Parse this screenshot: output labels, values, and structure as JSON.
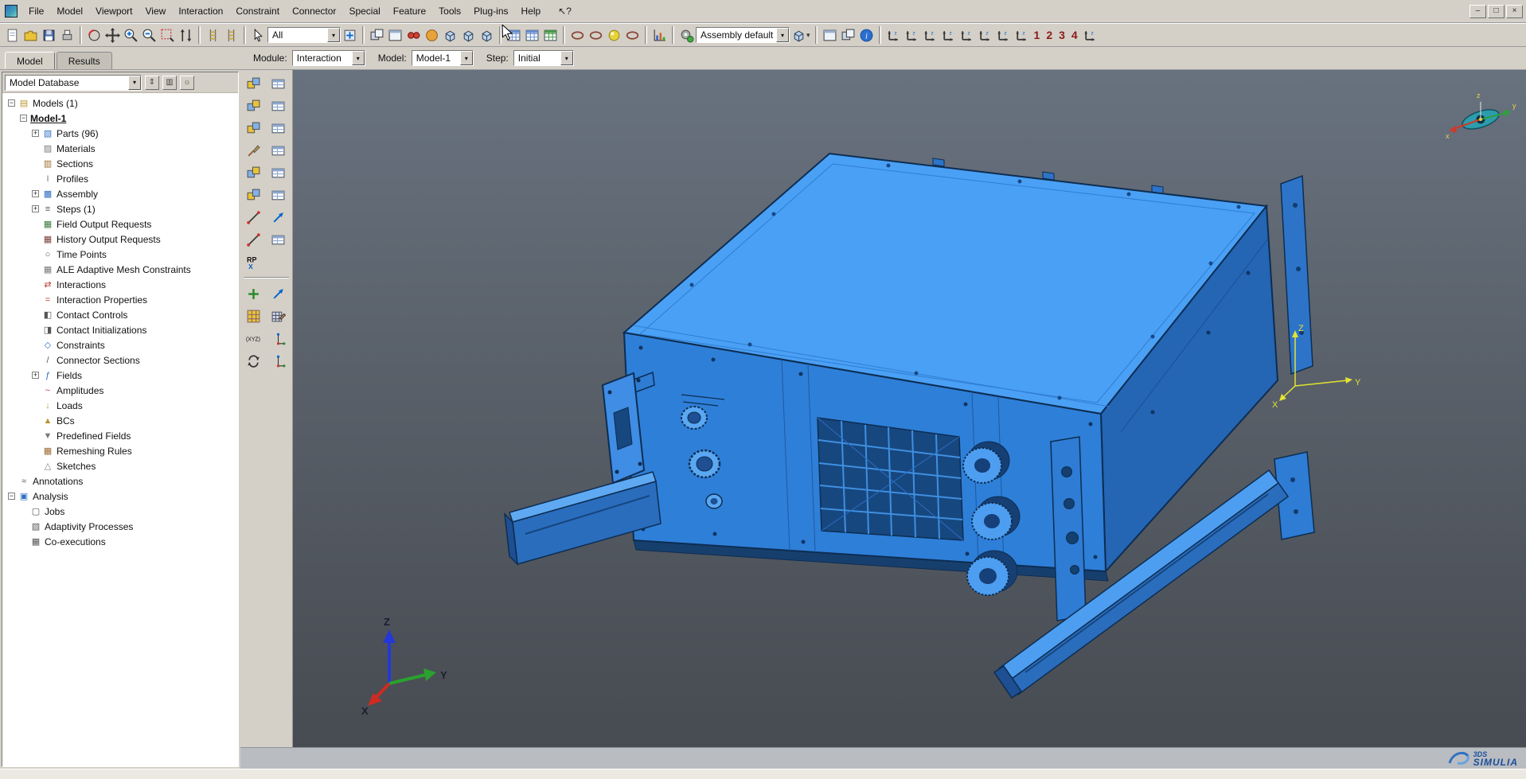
{
  "window": {
    "controls": [
      "minimize",
      "maximize",
      "close"
    ]
  },
  "menu_bar": {
    "items": [
      "File",
      "Model",
      "Viewport",
      "View",
      "Interaction",
      "Constraint",
      "Connector",
      "Special",
      "Feature",
      "Tools",
      "Plug-ins",
      "Help"
    ]
  },
  "toolbar": {
    "filter_combo": {
      "value": "All"
    },
    "defaults_combo": {
      "value": "Assembly defaults"
    },
    "viewport_numbers": [
      "1",
      "2",
      "3",
      "4"
    ],
    "groups": [
      [
        "new-file",
        "open-file",
        "save-file",
        "print"
      ],
      [
        "rotate-view",
        "pan-view",
        "magnify",
        "reduce",
        "box-zoom",
        "fit-view"
      ],
      [
        "create-display-group",
        "display-group-manager"
      ],
      [
        "select-tool",
        "combo:filter",
        "selection-add"
      ],
      [
        "overlay-viewports",
        "edit-viewport",
        "viewport-annotations",
        "shaded-render",
        "wireframe-view",
        "hiddenline-view",
        "shaded-view"
      ],
      [
        "field-output-table",
        "history-output-table",
        "data-table"
      ],
      [
        "beam-profile-a",
        "beam-profile-b",
        "sphere-render",
        "beam-profile-c"
      ],
      [
        "xy-plot"
      ],
      [
        "color-code",
        "combo:defaults",
        "color-dialog",
        "dropdown-arrow"
      ],
      [
        "create-viewport",
        "viewport-manager",
        "context-info"
      ],
      [
        "view-front",
        "view-back",
        "view-top",
        "view-bottom",
        "view-left",
        "view-right",
        "view-iso",
        "view-rotate3d",
        "num:0",
        "num:1",
        "num:2",
        "num:3",
        "custom-views"
      ]
    ]
  },
  "tabs": {
    "model": "Model",
    "results": "Results"
  },
  "context_bar": {
    "module_label": "Module:",
    "module_value": "Interaction",
    "model_label": "Model:",
    "model_value": "Model-1",
    "step_label": "Step:",
    "step_value": "Initial"
  },
  "model_tree": {
    "combo_value": "Model Database",
    "items": [
      {
        "label": "Models (1)",
        "depth": 0,
        "exp": "minus",
        "icon": "models-folder"
      },
      {
        "label": "Model-1",
        "depth": 1,
        "exp": "minus",
        "icon": null,
        "emph": true
      },
      {
        "label": "Parts (96)",
        "depth": 2,
        "exp": "plus",
        "icon": "parts"
      },
      {
        "label": "Materials",
        "depth": 2,
        "exp": null,
        "icon": "materials"
      },
      {
        "label": "Sections",
        "depth": 2,
        "exp": null,
        "icon": "sections"
      },
      {
        "label": "Profiles",
        "depth": 2,
        "exp": null,
        "icon": "profiles"
      },
      {
        "label": "Assembly",
        "depth": 2,
        "exp": "plus",
        "icon": "assembly"
      },
      {
        "label": "Steps (1)",
        "depth": 2,
        "exp": "plus",
        "icon": "steps"
      },
      {
        "label": "Field Output Requests",
        "depth": 2,
        "exp": null,
        "icon": "field-output"
      },
      {
        "label": "History Output Requests",
        "depth": 2,
        "exp": null,
        "icon": "history-output"
      },
      {
        "label": "Time Points",
        "depth": 2,
        "exp": null,
        "icon": "time-points"
      },
      {
        "label": "ALE Adaptive Mesh Constraints",
        "depth": 2,
        "exp": null,
        "icon": "ale-mesh"
      },
      {
        "label": "Interactions",
        "depth": 2,
        "exp": null,
        "icon": "interactions"
      },
      {
        "label": "Interaction Properties",
        "depth": 2,
        "exp": null,
        "icon": "interaction-properties"
      },
      {
        "label": "Contact Controls",
        "depth": 2,
        "exp": null,
        "icon": "contact-controls"
      },
      {
        "label": "Contact Initializations",
        "depth": 2,
        "exp": null,
        "icon": "contact-initializations"
      },
      {
        "label": "Constraints",
        "depth": 2,
        "exp": null,
        "icon": "constraints"
      },
      {
        "label": "Connector Sections",
        "depth": 2,
        "exp": null,
        "icon": "connector-sections"
      },
      {
        "label": "Fields",
        "depth": 2,
        "exp": "plus",
        "icon": "fields"
      },
      {
        "label": "Amplitudes",
        "depth": 2,
        "exp": null,
        "icon": "amplitudes"
      },
      {
        "label": "Loads",
        "depth": 2,
        "exp": null,
        "icon": "loads"
      },
      {
        "label": "BCs",
        "depth": 2,
        "exp": null,
        "icon": "bcs"
      },
      {
        "label": "Predefined Fields",
        "depth": 2,
        "exp": null,
        "icon": "predefined-fields"
      },
      {
        "label": "Remeshing Rules",
        "depth": 2,
        "exp": null,
        "icon": "remeshing-rules"
      },
      {
        "label": "Sketches",
        "depth": 2,
        "exp": null,
        "icon": "sketches"
      },
      {
        "label": "Annotations",
        "depth": 0,
        "exp": null,
        "icon": "annotations"
      },
      {
        "label": "Analysis",
        "depth": 0,
        "exp": "minus",
        "icon": "analysis"
      },
      {
        "label": "Jobs",
        "depth": 1,
        "exp": null,
        "icon": "jobs"
      },
      {
        "label": "Adaptivity Processes",
        "depth": 1,
        "exp": null,
        "icon": "adaptivity"
      },
      {
        "label": "Co-executions",
        "depth": 1,
        "exp": null,
        "icon": "co-executions"
      }
    ]
  },
  "toolbox": {
    "rp_label": "RP",
    "rp_axis": "X",
    "xyz_label": "(XYZ)",
    "rows": [
      [
        "create-interaction",
        "interaction-manager"
      ],
      [
        "create-interaction-property",
        "interaction-property-manager"
      ],
      [
        "create-contact-initialization",
        "contact-initialization-manager"
      ],
      [
        "create-contact-control",
        "contact-control-manager"
      ],
      [
        "create-constraint",
        "constraint-manager"
      ],
      [
        "create-connector-section",
        "connector-section-manager"
      ],
      [
        "create-wire-feature",
        "merge-wire"
      ],
      [
        "create-attachment-points",
        "attachment-manager"
      ],
      [
        "create-reference-point",
        null
      ],
      "separator",
      [
        "create-datum",
        "translate-instance"
      ],
      [
        "edit-mesh",
        "edit-feature"
      ],
      [
        "query-xyz",
        "datum-csys"
      ],
      [
        "view-rotate-tool",
        "datum-axis"
      ]
    ]
  },
  "viewport": {
    "triad": {
      "x": "X",
      "y": "Y",
      "z": "Z"
    },
    "csys_triad": {
      "x": "X",
      "y": "Y",
      "z": "Z"
    },
    "compass": {
      "x": "x",
      "y": "y",
      "z": "z"
    }
  },
  "brand": {
    "logo": "3DS",
    "name": "SIMULIA"
  },
  "colors": {
    "part_blue": "#2e7fd8",
    "part_blue_light": "#4aa0f4",
    "part_blue_dark": "#2465b4",
    "viewport_top": "#68727f",
    "viewport_bottom": "#474b52",
    "accent_red": "#8b1a1a"
  }
}
